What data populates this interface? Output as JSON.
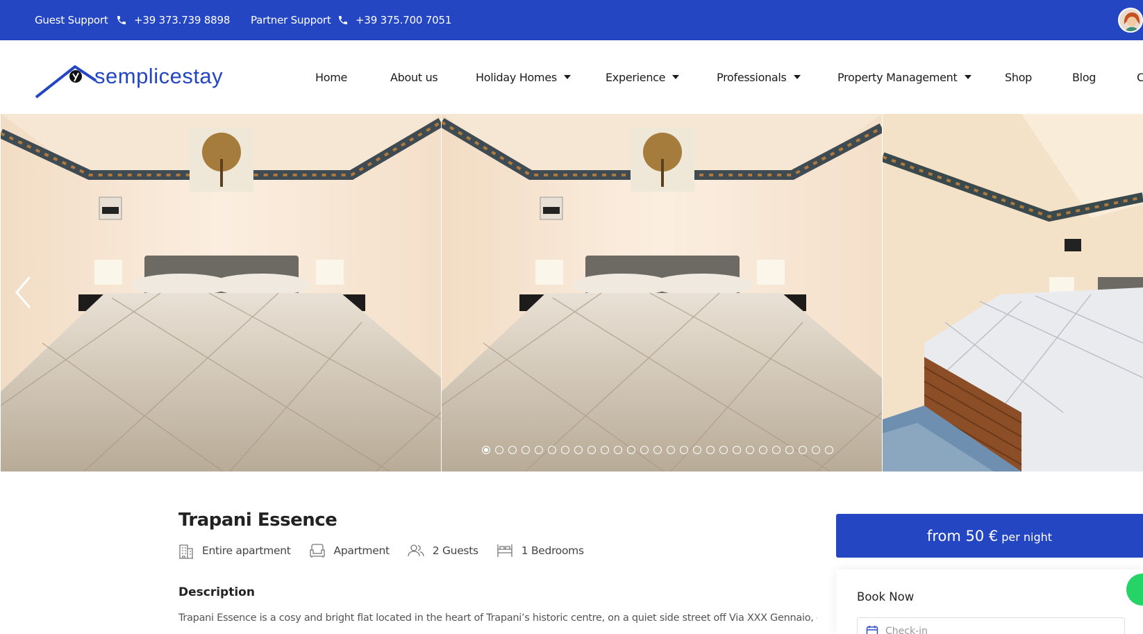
{
  "topbar": {
    "guest_support_label": "Guest Support",
    "guest_phone": "+39 373.739 8898",
    "partner_support_label": "Partner Support",
    "partner_phone": "+39 375.700 7051"
  },
  "brand": {
    "name": "semplicestay"
  },
  "nav": {
    "items": [
      {
        "label": "Home"
      },
      {
        "label": "About us"
      },
      {
        "label": "Holiday Homes"
      },
      {
        "label": "Experience"
      },
      {
        "label": "Professionals"
      },
      {
        "label": "Property Management"
      },
      {
        "label": "Shop"
      },
      {
        "label": "Blog"
      },
      {
        "label": "C"
      }
    ]
  },
  "gallery": {
    "slide_count": 27,
    "active_index": 0,
    "prev_icon": "chevron-left-icon"
  },
  "listing": {
    "title": "Trapani Essence",
    "features": [
      {
        "icon": "building-icon",
        "label": "Entire apartment"
      },
      {
        "icon": "sofa-icon",
        "label": "Apartment"
      },
      {
        "icon": "users-icon",
        "label": "2 Guests"
      },
      {
        "icon": "bed-icon",
        "label": "1 Bedrooms"
      }
    ],
    "description_heading": "Description",
    "description_text": "Trapani Essence is a cosy and bright flat located in the heart of Trapani’s historic centre, on a quiet side street off Via XXX Gennaio, close to"
  },
  "booking": {
    "price": "from 50 €",
    "price_unit": "per night",
    "title": "Book Now",
    "checkin_placeholder": "Check-in"
  },
  "colors": {
    "brand_blue": "#2546c3",
    "whatsapp_green": "#25d366"
  }
}
